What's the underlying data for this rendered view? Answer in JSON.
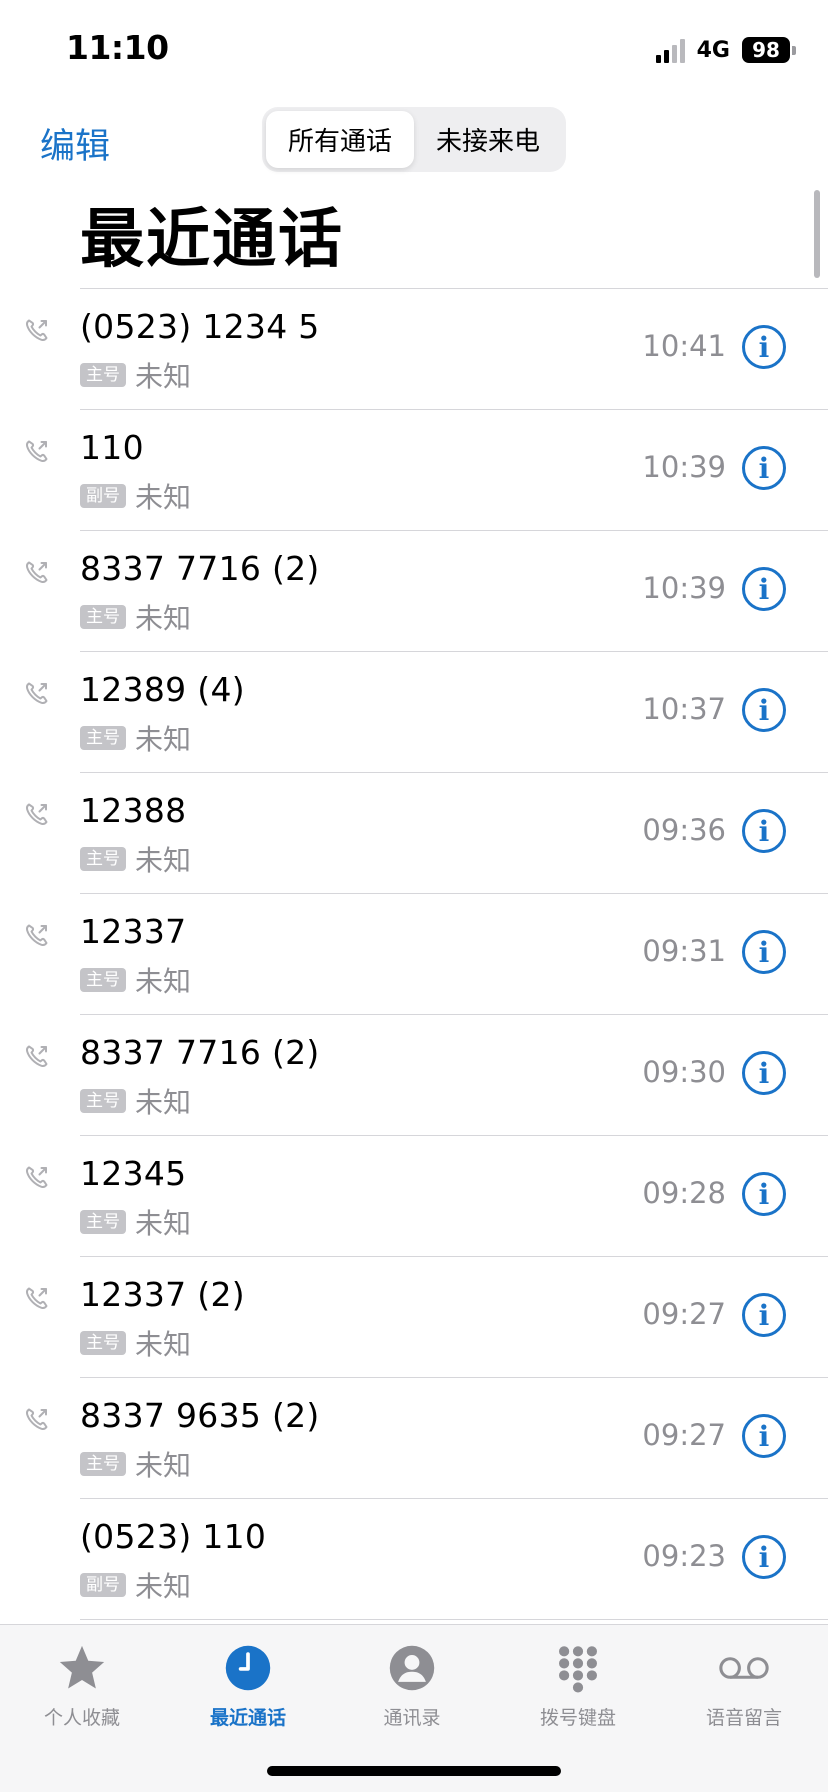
{
  "status_bar": {
    "time": "11:10",
    "network": "4G",
    "battery": "98"
  },
  "nav": {
    "edit_label": "编辑",
    "segments": [
      "所有通话",
      "未接来电"
    ],
    "active_segment": "所有通话"
  },
  "page_title": "最近通话",
  "calls": [
    {
      "number": "(0523) 1234 5",
      "sim": "主号",
      "label": "未知",
      "time": "10:41",
      "outgoing_icon": true
    },
    {
      "number": "110",
      "sim": "副号",
      "label": "未知",
      "time": "10:39",
      "outgoing_icon": true
    },
    {
      "number": "8337 7716 (2)",
      "sim": "主号",
      "label": "未知",
      "time": "10:39",
      "outgoing_icon": true
    },
    {
      "number": "12389 (4)",
      "sim": "主号",
      "label": "未知",
      "time": "10:37",
      "outgoing_icon": true
    },
    {
      "number": "12388",
      "sim": "主号",
      "label": "未知",
      "time": "09:36",
      "outgoing_icon": true
    },
    {
      "number": "12337",
      "sim": "主号",
      "label": "未知",
      "time": "09:31",
      "outgoing_icon": true
    },
    {
      "number": "8337 7716 (2)",
      "sim": "主号",
      "label": "未知",
      "time": "09:30",
      "outgoing_icon": true
    },
    {
      "number": "12345",
      "sim": "主号",
      "label": "未知",
      "time": "09:28",
      "outgoing_icon": true
    },
    {
      "number": "12337 (2)",
      "sim": "主号",
      "label": "未知",
      "time": "09:27",
      "outgoing_icon": true
    },
    {
      "number": "8337 9635 (2)",
      "sim": "主号",
      "label": "未知",
      "time": "09:27",
      "outgoing_icon": true
    },
    {
      "number": "(0523) 110",
      "sim": "副号",
      "label": "未知",
      "time": "09:23",
      "outgoing_icon": false
    }
  ],
  "tabs": [
    {
      "label": "个人收藏",
      "icon": "star-icon",
      "active": false
    },
    {
      "label": "最近通话",
      "icon": "clock-icon",
      "active": true
    },
    {
      "label": "通讯录",
      "icon": "contact-icon",
      "active": false
    },
    {
      "label": "拨号键盘",
      "icon": "keypad-icon",
      "active": false
    },
    {
      "label": "语音留言",
      "icon": "voicemail-icon",
      "active": false
    }
  ],
  "colors": {
    "accent": "#1a73c8",
    "secondary_text": "#8e8e93",
    "badge": "#c4c4c8"
  }
}
